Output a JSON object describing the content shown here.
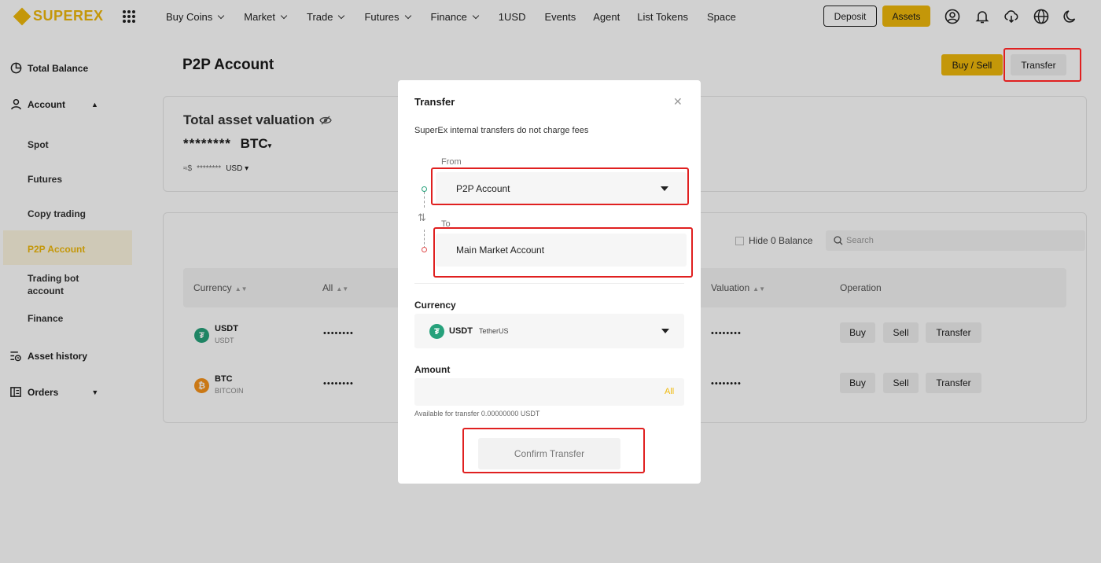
{
  "brand": {
    "name": "SUPEREX",
    "color": "#f0b90b"
  },
  "nav": {
    "items": [
      {
        "label": "Buy Coins",
        "dropdown": true
      },
      {
        "label": "Market",
        "dropdown": true
      },
      {
        "label": "Trade",
        "dropdown": true
      },
      {
        "label": "Futures",
        "dropdown": true
      },
      {
        "label": "Finance",
        "dropdown": true
      },
      {
        "label": "1USD",
        "dropdown": false
      },
      {
        "label": "Events",
        "dropdown": false
      },
      {
        "label": "Agent",
        "dropdown": false
      },
      {
        "label": "List Tokens",
        "dropdown": false
      },
      {
        "label": "Space",
        "dropdown": false
      }
    ],
    "deposit_label": "Deposit",
    "assets_label": "Assets",
    "icons": [
      "user-icon",
      "bell-icon",
      "download-icon",
      "globe-icon",
      "moon-icon"
    ]
  },
  "sidebar": {
    "total_balance": "Total Balance",
    "account": "Account",
    "spot": "Spot",
    "futures": "Futures",
    "copy_trading": "Copy trading",
    "p2p_account": "P2P Account",
    "trading_bot_line1": "Trading bot",
    "trading_bot_line2": "account",
    "finance": "Finance",
    "asset_history": "Asset history",
    "orders": "Orders",
    "active_color": "#f0b90b"
  },
  "page": {
    "title": "P2P Account",
    "buy_sell_label": "Buy / Sell",
    "transfer_label": "Transfer"
  },
  "valuation": {
    "title": "Total asset valuation",
    "masked_value": "********",
    "currency": "BTC",
    "approx_prefix": "≈$",
    "approx_masked": "********",
    "fiat": "USD"
  },
  "assets_table": {
    "hide_zero_label": "Hide 0 Balance",
    "search_placeholder": "Search",
    "headers": {
      "currency": "Currency",
      "all": "All",
      "valuation": "Valuation",
      "operation": "Operation"
    },
    "rows": [
      {
        "symbol": "USDT",
        "name": "USDT",
        "all": "••••••••",
        "valuation": "••••••••",
        "icon_color": "#26a17b",
        "icon_glyph": "₮"
      },
      {
        "symbol": "BTC",
        "name": "BITCOIN",
        "all": "••••••••",
        "valuation": "••••••••",
        "icon_color": "#f7931a",
        "icon_glyph": "₿"
      }
    ],
    "ops": {
      "buy": "Buy",
      "sell": "Sell",
      "transfer": "Transfer"
    }
  },
  "modal": {
    "title": "Transfer",
    "note": "SuperEx internal transfers do not charge fees",
    "from_label": "From",
    "from_value": "P2P Account",
    "to_label": "To",
    "to_value": "Main Market Account",
    "currency_heading": "Currency",
    "currency_symbol": "USDT",
    "currency_name": "TetherUS",
    "amount_heading": "Amount",
    "amount_value": "",
    "amount_all": "All",
    "available_text": "Available for transfer 0.00000000 USDT",
    "confirm_label": "Confirm Transfer"
  },
  "highlight_color": "#e02020"
}
